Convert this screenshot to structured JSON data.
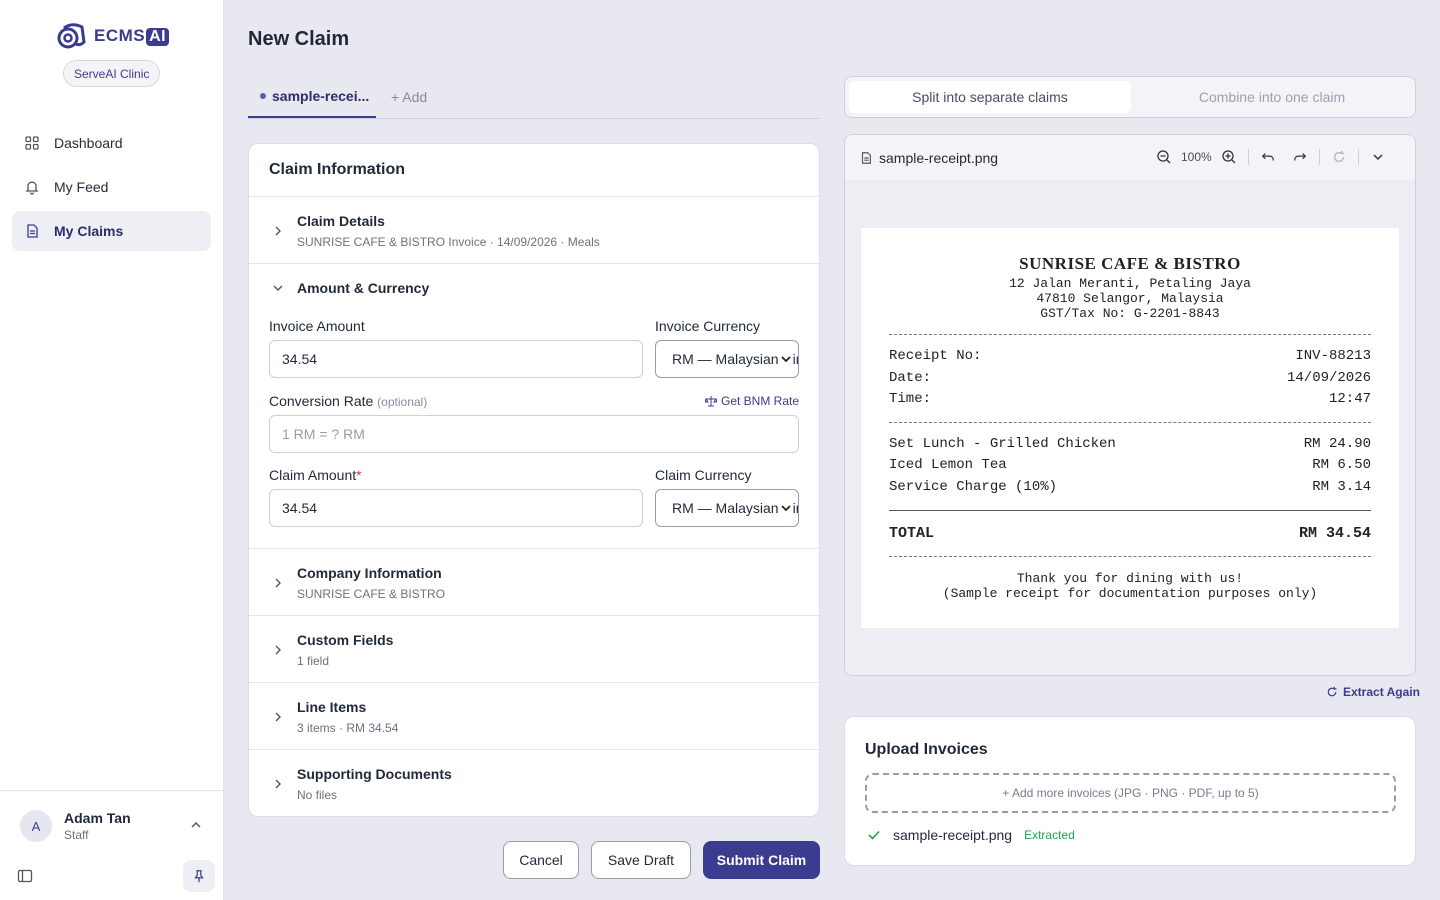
{
  "brand": {
    "name": "ECMS",
    "suffix": "AI",
    "org": "ServeAI Clinic"
  },
  "nav": [
    {
      "label": "Dashboard",
      "icon": "grid-icon"
    },
    {
      "label": "My Feed",
      "icon": "bell-icon"
    },
    {
      "label": "My Claims",
      "icon": "document-icon",
      "active": true
    }
  ],
  "user": {
    "initial": "A",
    "name": "Adam Tan",
    "role": "Staff"
  },
  "page": {
    "title": "New Claim"
  },
  "tabs": {
    "active": "sample-recei...",
    "add": "+ Add"
  },
  "claim": {
    "title": "Claim Information",
    "details": {
      "label": "Claim Details",
      "summary": "SUNRISE CAFE & BISTRO Invoice · 14/09/2026 · Meals"
    },
    "amount": {
      "label": "Amount & Currency",
      "invoice_amount_label": "Invoice Amount",
      "invoice_amount": "34.54",
      "invoice_currency_label": "Invoice Currency",
      "invoice_currency": "RM — Malaysian Ringgit",
      "conversion_label": "Conversion Rate",
      "conversion_optional": "(optional)",
      "bnm_link": "Get BNM Rate",
      "conversion_placeholder": "1 RM = ? RM",
      "claim_amount_label": "Claim Amount",
      "required_mark": "*",
      "claim_amount": "34.54",
      "claim_currency_label": "Claim Currency",
      "claim_currency": "RM — Malaysian Ringgit"
    },
    "company": {
      "label": "Company Information",
      "summary": "SUNRISE CAFE & BISTRO"
    },
    "custom": {
      "label": "Custom Fields",
      "summary": "1 field"
    },
    "lines": {
      "label": "Line Items",
      "summary": "3 items · RM 34.54"
    },
    "docs": {
      "label": "Supporting Documents",
      "summary": "No files"
    }
  },
  "actions": {
    "cancel": "Cancel",
    "save": "Save Draft",
    "submit": "Submit Claim"
  },
  "mode": {
    "split": "Split into separate claims",
    "combine": "Combine into one claim"
  },
  "viewer": {
    "filename": "sample-receipt.png",
    "zoom": "100%"
  },
  "receipt": {
    "name": "SUNRISE CAFE & BISTRO",
    "addr1": "12 Jalan Meranti, Petaling Jaya",
    "addr2": "47810 Selangor, Malaysia",
    "tax": "GST/Tax No: G-2201-8843",
    "meta": [
      {
        "k": "Receipt No:",
        "v": "INV-88213"
      },
      {
        "k": "Date:",
        "v": "14/09/2026"
      },
      {
        "k": "Time:",
        "v": "12:47"
      }
    ],
    "items": [
      {
        "k": "Set Lunch - Grilled Chicken",
        "v": "RM 24.90"
      },
      {
        "k": "Iced Lemon Tea",
        "v": "RM 6.50"
      },
      {
        "k": "Service Charge (10%)",
        "v": "RM 3.14"
      }
    ],
    "total_label": "TOTAL",
    "total_value": "RM 34.54",
    "thanks": "Thank you for dining with us!",
    "note": "(Sample receipt for documentation purposes only)"
  },
  "extract_again": "Extract Again",
  "upload": {
    "title": "Upload Invoices",
    "dropzone": "+ Add more invoices (JPG · PNG · PDF, up to 5)",
    "file": "sample-receipt.png",
    "status": "Extracted"
  },
  "colors": {
    "accent": "#3b3b8f",
    "success": "#22a34a",
    "required": "#e03a3a"
  }
}
